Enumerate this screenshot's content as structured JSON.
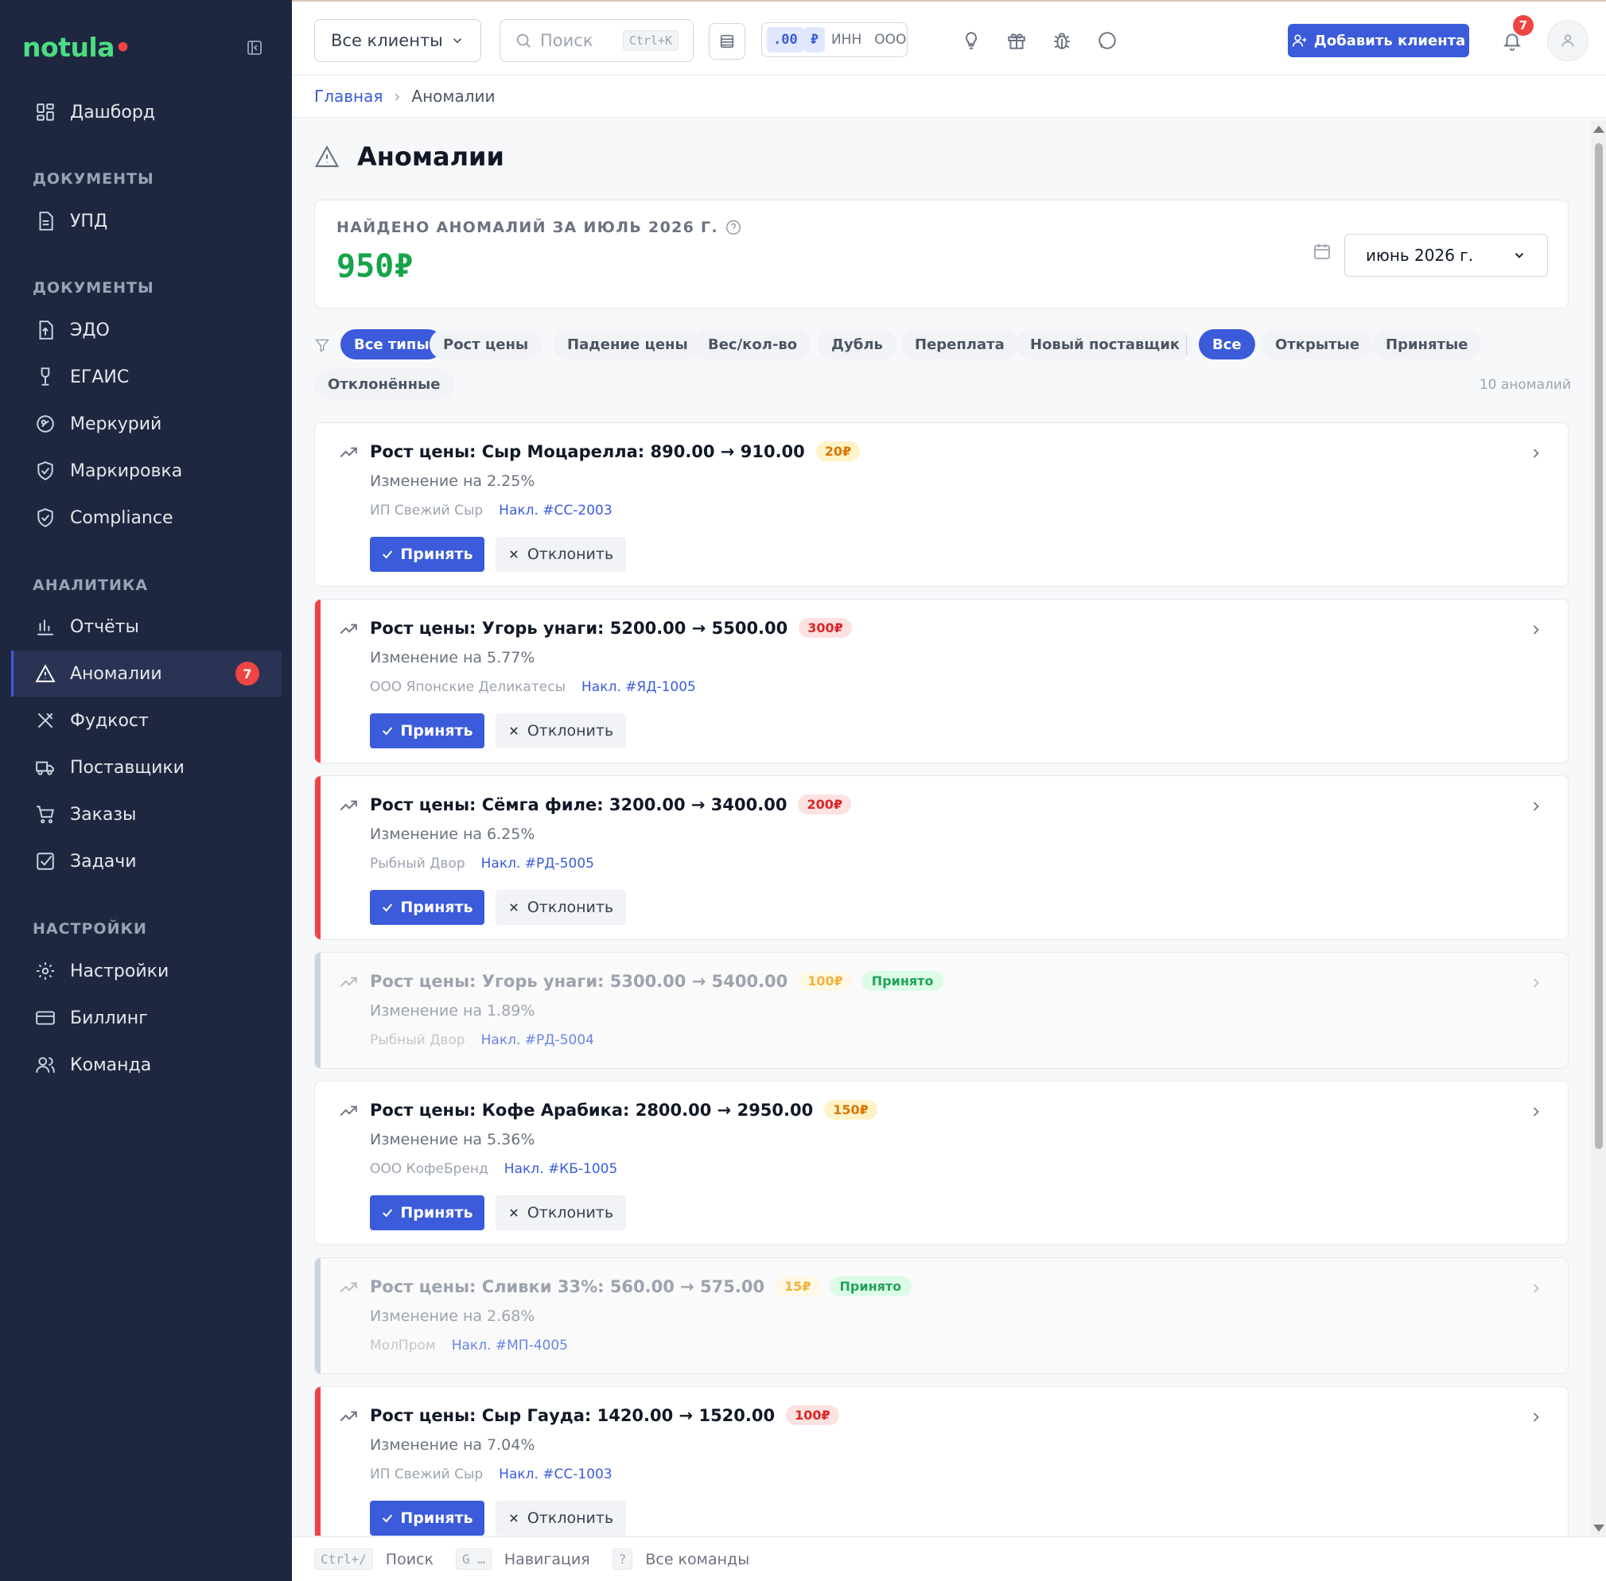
{
  "sidebar": {
    "logo": "notula",
    "items": [
      {
        "label": "Дашборд"
      },
      {
        "section": "ДОКУМЕНТЫ"
      },
      {
        "label": "УПД"
      },
      {
        "section": "ДОКУМЕНТЫ"
      },
      {
        "label": "ЭДО"
      },
      {
        "label": "ЕГАИС"
      },
      {
        "label": "Меркурий"
      },
      {
        "label": "Маркировка"
      },
      {
        "label": "Compliance"
      },
      {
        "section": "АНАЛИТИКА"
      },
      {
        "label": "Отчёты"
      },
      {
        "label": "Аномалии",
        "badge": "7"
      },
      {
        "label": "Фудкост"
      },
      {
        "label": "Поставщики"
      },
      {
        "label": "Заказы"
      },
      {
        "label": "Задачи"
      },
      {
        "section": "НАСТРОЙКИ"
      },
      {
        "label": "Настройки"
      },
      {
        "label": "Биллинг"
      },
      {
        "label": "Команда"
      }
    ]
  },
  "topbar": {
    "client_select": "Все клиенты",
    "search_placeholder": "Поиск",
    "search_shortcut": "Ctrl+K",
    "formats": [
      ".00",
      "₽",
      "ИНН",
      "ООО"
    ],
    "add_client": "Добавить клиента",
    "notifications": "7"
  },
  "breadcrumb": {
    "home": "Главная",
    "sep": "›",
    "current": "Аномалии"
  },
  "page": {
    "title": "Аномалии",
    "summary_label": "НАЙДЕНО АНОМАЛИЙ ЗА ИЮЛЬ 2026 Г.",
    "summary_value": "950₽",
    "month": "июнь 2026 г."
  },
  "filters": {
    "types": [
      "Все типы",
      "Рост цены",
      "Падение цены",
      "Вес/кол-во",
      "Дубль",
      "Переплата",
      "Новый поставщик"
    ],
    "statuses": [
      "Все",
      "Открытые",
      "Принятые",
      "Отклонённые"
    ],
    "count": "10 аномалий"
  },
  "actions": {
    "accept": "Принять",
    "reject": "Отклонить"
  },
  "anomalies": [
    {
      "title": "Рост цены: Сыр Моцарелла: 890.00 → 910.00",
      "amount": "20₽",
      "level": "orange",
      "change": "Изменение на 2.25%",
      "supplier": "ИП Свежий Сыр",
      "invoice": "Накл. #СС-2003",
      "status": ""
    },
    {
      "title": "Рост цены: Угорь унаги: 5200.00 → 5500.00",
      "amount": "300₽",
      "level": "red",
      "change": "Изменение на 5.77%",
      "supplier": "ООО Японские Деликатесы",
      "invoice": "Накл. #ЯД-1005",
      "status": ""
    },
    {
      "title": "Рост цены: Сёмга филе: 3200.00 → 3400.00",
      "amount": "200₽",
      "level": "red",
      "change": "Изменение на 6.25%",
      "supplier": "Рыбный Двор",
      "invoice": "Накл. #РД-5005",
      "status": ""
    },
    {
      "title": "Рост цены: Угорь унаги: 5300.00 → 5400.00",
      "amount": "100₽",
      "level": "orange",
      "change": "Изменение на 1.89%",
      "supplier": "Рыбный Двор",
      "invoice": "Накл. #РД-5004",
      "status": "Принято"
    },
    {
      "title": "Рост цены: Кофе Арабика: 2800.00 → 2950.00",
      "amount": "150₽",
      "level": "orange",
      "change": "Изменение на 5.36%",
      "supplier": "ООО КофеБренд",
      "invoice": "Накл. #КБ-1005",
      "status": ""
    },
    {
      "title": "Рост цены: Сливки 33%: 560.00 → 575.00",
      "amount": "15₽",
      "level": "orange",
      "change": "Изменение на 2.68%",
      "supplier": "МолПром",
      "invoice": "Накл. #МП-4005",
      "status": "Принято"
    },
    {
      "title": "Рост цены: Сыр Гауда: 1420.00 → 1520.00",
      "amount": "100₽",
      "level": "red",
      "change": "Изменение на 7.04%",
      "supplier": "ИП Свежий Сыр",
      "invoice": "Накл. #СС-1003",
      "status": ""
    }
  ],
  "hints": [
    {
      "key": "Ctrl+/",
      "label": "Поиск"
    },
    {
      "key": "G …",
      "label": "Навигация"
    },
    {
      "key": "?",
      "label": "Все команды"
    }
  ],
  "colors": {
    "accent": "#3b5bdb",
    "sidebar": "#1f2740",
    "danger": "#ef4444",
    "warning": "#d97706",
    "success": "#16a34a"
  }
}
